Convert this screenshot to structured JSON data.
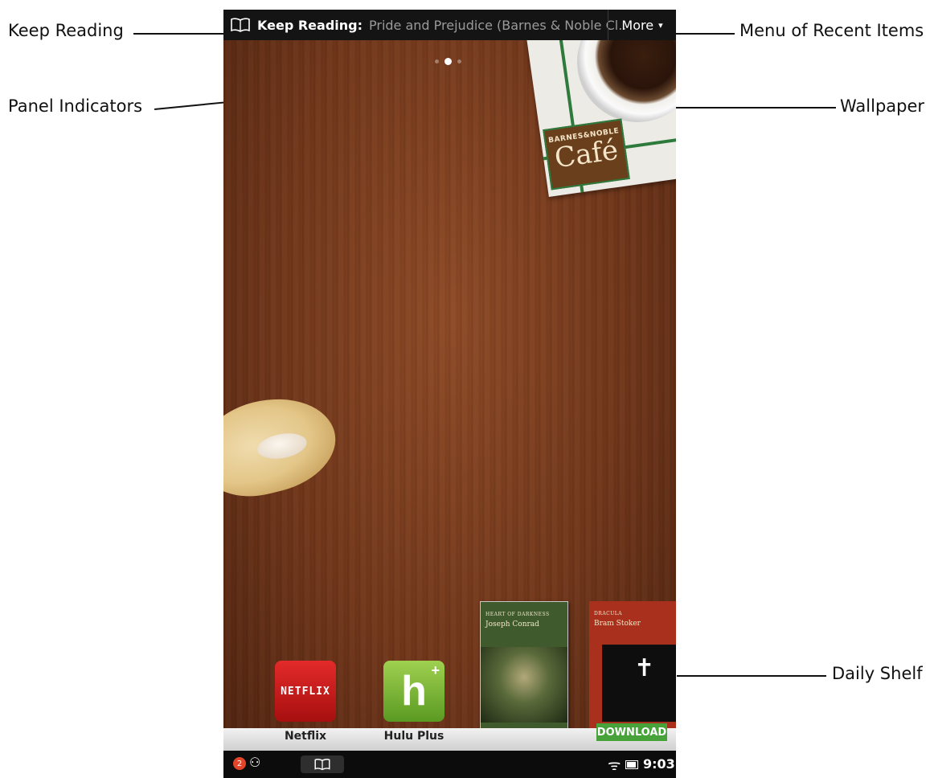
{
  "callouts": {
    "keep_reading": "Keep Reading",
    "panel_indicators": "Panel Indicators",
    "menu_recent": "Menu of Recent Items",
    "wallpaper": "Wallpaper",
    "daily_shelf": "Daily Shelf"
  },
  "topbar": {
    "label": "Keep Reading:",
    "title": "Pride and Prejudice (Barnes & Noble Cl...",
    "more": "More",
    "more_caret": "▾"
  },
  "panels": {
    "count": 3,
    "active_index": 1
  },
  "wallpaper": {
    "brand_small": "BARNES&NOBLE",
    "brand_big": "Café"
  },
  "apps": [
    {
      "name": "Netflix",
      "icon_text": "NETFLIX",
      "icon": "netflix-icon"
    },
    {
      "name": "Hulu Plus",
      "icon_text": "h",
      "icon": "hulu-plus-icon"
    }
  ],
  "books": [
    {
      "title": "HEART OF DARKNESS",
      "author": "Joseph Conrad"
    },
    {
      "title": "DRACULA",
      "author": "Bram Stoker",
      "badge": "DOWNLOAD"
    }
  ],
  "status": {
    "notifications": "2",
    "time": "9:03"
  },
  "colors": {
    "accent_green": "#48a23a",
    "topbar": "#141414",
    "wood": "#7a3c1e"
  }
}
